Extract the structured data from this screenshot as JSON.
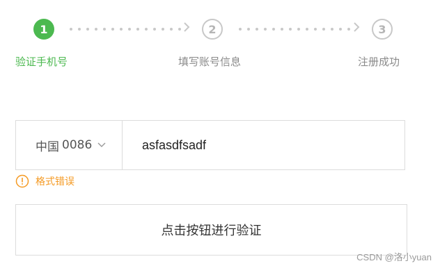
{
  "stepper": {
    "steps": [
      {
        "number": "1",
        "label": "验证手机号",
        "state": "active"
      },
      {
        "number": "2",
        "label": "填写账号信息",
        "state": "pending"
      },
      {
        "number": "3",
        "label": "注册成功",
        "state": "pending"
      }
    ],
    "active_color": "#4cb950",
    "idle_color": "#c8c8c8"
  },
  "phone": {
    "country": "中国",
    "code": "0086",
    "value": "asfasdfsadf"
  },
  "error": {
    "text": "格式错误",
    "color": "#f59a23",
    "icon": "warning-circle-icon"
  },
  "verify_button": {
    "label": "点击按钮进行验证"
  },
  "watermark": "CSDN @洛小yuan"
}
